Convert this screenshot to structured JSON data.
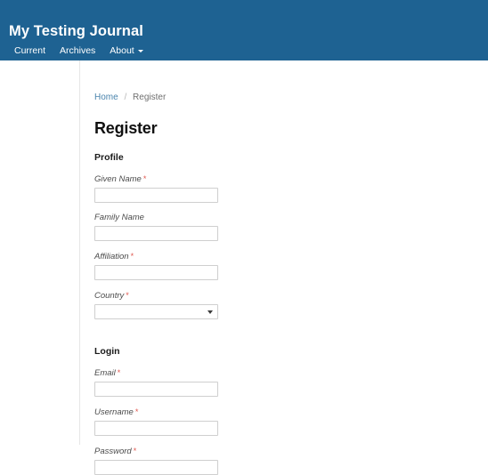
{
  "masthead": {
    "site_title": "My Testing Journal",
    "background_color": "#1e6292",
    "nav": [
      {
        "label": "Current",
        "has_caret": false
      },
      {
        "label": "Archives",
        "has_caret": false
      },
      {
        "label": "About",
        "has_caret": true
      }
    ]
  },
  "breadcrumb": {
    "home_label": "Home",
    "separator": "/",
    "current_label": "Register"
  },
  "main": {
    "page_title": "Register",
    "required_marker": "*",
    "required_color": "#e0584f",
    "link_color": "#4a84ad",
    "sections": [
      {
        "heading": "Profile",
        "fields": [
          {
            "label": "Given Name",
            "required": true,
            "type": "text",
            "value": ""
          },
          {
            "label": "Family Name",
            "required": false,
            "type": "text",
            "value": ""
          },
          {
            "label": "Affiliation",
            "required": true,
            "type": "text",
            "value": ""
          },
          {
            "label": "Country",
            "required": true,
            "type": "select",
            "value": ""
          }
        ]
      },
      {
        "heading": "Login",
        "fields": [
          {
            "label": "Email",
            "required": true,
            "type": "text",
            "value": ""
          },
          {
            "label": "Username",
            "required": true,
            "type": "text",
            "value": ""
          },
          {
            "label": "Password",
            "required": true,
            "type": "password",
            "value": ""
          }
        ]
      }
    ]
  }
}
